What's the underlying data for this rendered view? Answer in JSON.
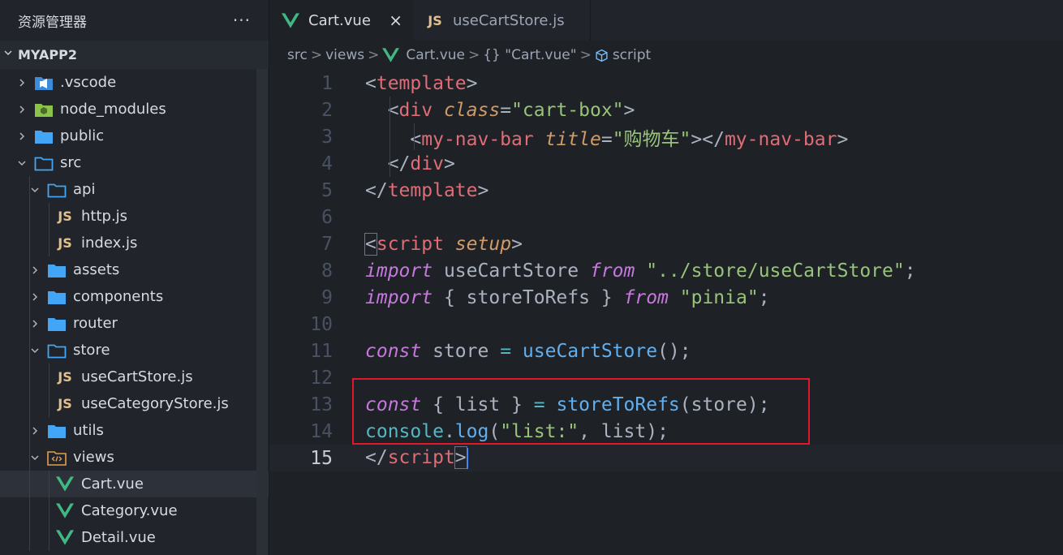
{
  "explorer": {
    "title": "资源管理器",
    "more": "···",
    "project": "MYAPP2",
    "items": [
      {
        "label": ".vscode",
        "type": "folder-vscode",
        "expanded": false,
        "depth": 0
      },
      {
        "label": "node_modules",
        "type": "folder-node",
        "expanded": false,
        "depth": 0
      },
      {
        "label": "public",
        "type": "folder",
        "expanded": false,
        "depth": 0
      },
      {
        "label": "src",
        "type": "folder",
        "expanded": true,
        "depth": 0
      },
      {
        "label": "api",
        "type": "folder",
        "expanded": true,
        "depth": 1
      },
      {
        "label": "http.js",
        "type": "js",
        "depth": 2
      },
      {
        "label": "index.js",
        "type": "js",
        "depth": 2
      },
      {
        "label": "assets",
        "type": "folder",
        "expanded": false,
        "depth": 1
      },
      {
        "label": "components",
        "type": "folder",
        "expanded": false,
        "depth": 1
      },
      {
        "label": "router",
        "type": "folder",
        "expanded": false,
        "depth": 1
      },
      {
        "label": "store",
        "type": "folder",
        "expanded": true,
        "depth": 1
      },
      {
        "label": "useCartStore.js",
        "type": "js",
        "depth": 2
      },
      {
        "label": "useCategoryStore.js",
        "type": "js",
        "depth": 2
      },
      {
        "label": "utils",
        "type": "folder",
        "expanded": false,
        "depth": 1
      },
      {
        "label": "views",
        "type": "folder-views",
        "expanded": true,
        "depth": 1
      },
      {
        "label": "Cart.vue",
        "type": "vue",
        "depth": 2,
        "active": true
      },
      {
        "label": "Category.vue",
        "type": "vue",
        "depth": 2
      },
      {
        "label": "Detail.vue",
        "type": "vue",
        "depth": 2
      }
    ]
  },
  "tabs": [
    {
      "label": "Cart.vue",
      "icon": "vue-icon",
      "active": true,
      "close": "×"
    },
    {
      "label": "useCartStore.js",
      "icon": "js-icon",
      "active": false
    }
  ],
  "js_badge": "JS",
  "breadcrumb": {
    "parts": [
      "src",
      "views",
      "Cart.vue",
      "{} \"Cart.vue\"",
      "script"
    ],
    "separator": ">"
  },
  "editor": {
    "current_line": 15,
    "lines": [
      {
        "n": "1",
        "tokens": [
          [
            "t-p",
            "<"
          ],
          [
            "t-tag",
            "template"
          ],
          [
            "t-p",
            ">"
          ]
        ]
      },
      {
        "n": "2",
        "tokens": [
          [
            "t-p",
            "  <"
          ],
          [
            "t-tag",
            "div"
          ],
          [
            "t-p",
            " "
          ],
          [
            "t-attr",
            "class"
          ],
          [
            "t-p",
            "="
          ],
          [
            "t-str",
            "\"cart-box\""
          ],
          [
            "t-p",
            ">"
          ]
        ]
      },
      {
        "n": "3",
        "tokens": [
          [
            "t-p",
            "    <"
          ],
          [
            "t-tag",
            "my-nav-bar"
          ],
          [
            "t-p",
            " "
          ],
          [
            "t-attr",
            "title"
          ],
          [
            "t-p",
            "="
          ],
          [
            "t-str",
            "\"购物车\""
          ],
          [
            "t-p",
            "></"
          ],
          [
            "t-tag",
            "my-nav-bar"
          ],
          [
            "t-p",
            ">"
          ]
        ]
      },
      {
        "n": "4",
        "tokens": [
          [
            "t-p",
            "  </"
          ],
          [
            "t-tag",
            "div"
          ],
          [
            "t-p",
            ">"
          ]
        ]
      },
      {
        "n": "5",
        "tokens": [
          [
            "t-p",
            "</"
          ],
          [
            "t-tag",
            "template"
          ],
          [
            "t-p",
            ">"
          ]
        ]
      },
      {
        "n": "6",
        "tokens": []
      },
      {
        "n": "7",
        "tokens": [
          [
            "t-p bracket-box",
            "<"
          ],
          [
            "t-tag",
            "script"
          ],
          [
            "t-p",
            " "
          ],
          [
            "t-attr",
            "setup"
          ],
          [
            "t-p",
            ">"
          ]
        ]
      },
      {
        "n": "8",
        "tokens": [
          [
            "t-kw",
            "import"
          ],
          [
            "t-p",
            " useCartStore "
          ],
          [
            "t-kw",
            "from"
          ],
          [
            "t-p",
            " "
          ],
          [
            "t-str",
            "\"../store/useCartStore\""
          ],
          [
            "t-p",
            ";"
          ]
        ]
      },
      {
        "n": "9",
        "tokens": [
          [
            "t-kw",
            "import"
          ],
          [
            "t-p",
            " { storeToRefs } "
          ],
          [
            "t-kw",
            "from"
          ],
          [
            "t-p",
            " "
          ],
          [
            "t-str",
            "\"pinia\""
          ],
          [
            "t-p",
            ";"
          ]
        ]
      },
      {
        "n": "10",
        "tokens": []
      },
      {
        "n": "11",
        "tokens": [
          [
            "t-kw",
            "const"
          ],
          [
            "t-p",
            " store "
          ],
          [
            "t-cn",
            "="
          ],
          [
            "t-p",
            " "
          ],
          [
            "t-fn",
            "useCartStore"
          ],
          [
            "t-p",
            "();"
          ]
        ]
      },
      {
        "n": "12",
        "tokens": []
      },
      {
        "n": "13",
        "tokens": [
          [
            "t-kw",
            "const"
          ],
          [
            "t-p",
            " { list } "
          ],
          [
            "t-cn",
            "="
          ],
          [
            "t-p",
            " "
          ],
          [
            "t-fn",
            "storeToRefs"
          ],
          [
            "t-p",
            "(store);"
          ]
        ]
      },
      {
        "n": "14",
        "tokens": [
          [
            "t-cn",
            "console"
          ],
          [
            "t-p",
            "."
          ],
          [
            "t-fn",
            "log"
          ],
          [
            "t-p",
            "("
          ],
          [
            "t-str",
            "\"list:\""
          ],
          [
            "t-p",
            ", list);"
          ]
        ]
      },
      {
        "n": "15",
        "tokens": [
          [
            "t-p",
            "</"
          ],
          [
            "t-tag",
            "script"
          ],
          [
            "t-p bracket-box",
            ">"
          ]
        ]
      }
    ]
  },
  "colors": {
    "highlight_box": "#e0182b",
    "vue_green": "#41b883",
    "folder_blue": "#42a5f5",
    "js_yellow": "#e2c08d"
  }
}
